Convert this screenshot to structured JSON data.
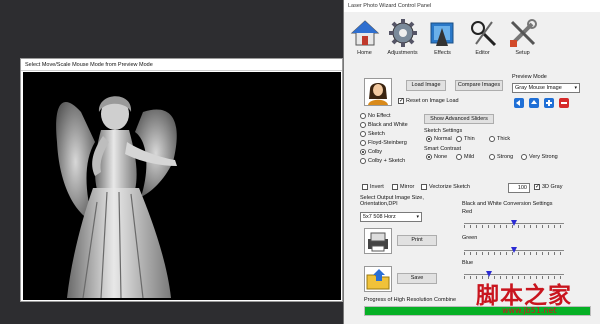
{
  "preview": {
    "title": "Select Move/Scale Mouse Mode from Preview Mode"
  },
  "panel": {
    "title": "Laser Photo Wizard Control Panel",
    "toolbar": [
      {
        "label": "Home",
        "icon": "house-icon"
      },
      {
        "label": "Adjustments",
        "icon": "gear-icon"
      },
      {
        "label": "Effects",
        "icon": "effects-icon"
      },
      {
        "label": "Editor",
        "icon": "editor-icon"
      },
      {
        "label": "Setup",
        "icon": "tools-icon"
      }
    ],
    "load_image": "Load Image",
    "compare_images": "Compare Images",
    "preview_mode_label": "Preview Mode",
    "preview_mode_value": "Gray Mouse Image",
    "reset_on_load": "Reset on Image Load",
    "show_advanced": "Show Advanced Sliders",
    "effects": [
      {
        "label": "No Effect",
        "selected": false
      },
      {
        "label": "Black and White",
        "selected": false
      },
      {
        "label": "Sketch",
        "selected": false
      },
      {
        "label": "Floyd-Steinberg",
        "selected": false
      },
      {
        "label": "Colby",
        "selected": true
      },
      {
        "label": "Colby + Sketch",
        "selected": false
      }
    ],
    "sketch_settings_label": "Sketch Settings",
    "sketch_settings": [
      {
        "label": "Normal",
        "selected": true
      },
      {
        "label": "Thin",
        "selected": false
      },
      {
        "label": "Thick",
        "selected": false
      }
    ],
    "smart_contrast_label": "Smart Contrast",
    "smart_contrast": [
      {
        "label": "None",
        "selected": true
      },
      {
        "label": "Mild",
        "selected": false
      },
      {
        "label": "Strong",
        "selected": false
      },
      {
        "label": "Very Strong",
        "selected": false
      }
    ],
    "invert": "Invert",
    "mirror": "Mirror",
    "vectorize_sketch": "Vectorize Sketch",
    "zoom_value": "100",
    "three_d_gray": "3D Gray",
    "output_size_label": "Select Output Image Size, Orientation,DPI",
    "output_size_value": "5x7 508 Horz",
    "bw_settings_label": "Black and White Conversion Settings",
    "red_label": "Red",
    "green_label": "Green",
    "blue_label": "Blue",
    "red_level": 0.5,
    "green_level": 0.5,
    "blue_level": 0.25,
    "print": "Print",
    "save": "Save",
    "progress_label": "Progress of High Resolution Combine",
    "progress_value": 1.0,
    "colors": {
      "progress_fill": "#06b025",
      "slider_thumb": "#2b2bd4",
      "watermark": "#c9151e"
    }
  },
  "watermark": {
    "text": "脚本之家",
    "url": "www.jb51.net"
  }
}
